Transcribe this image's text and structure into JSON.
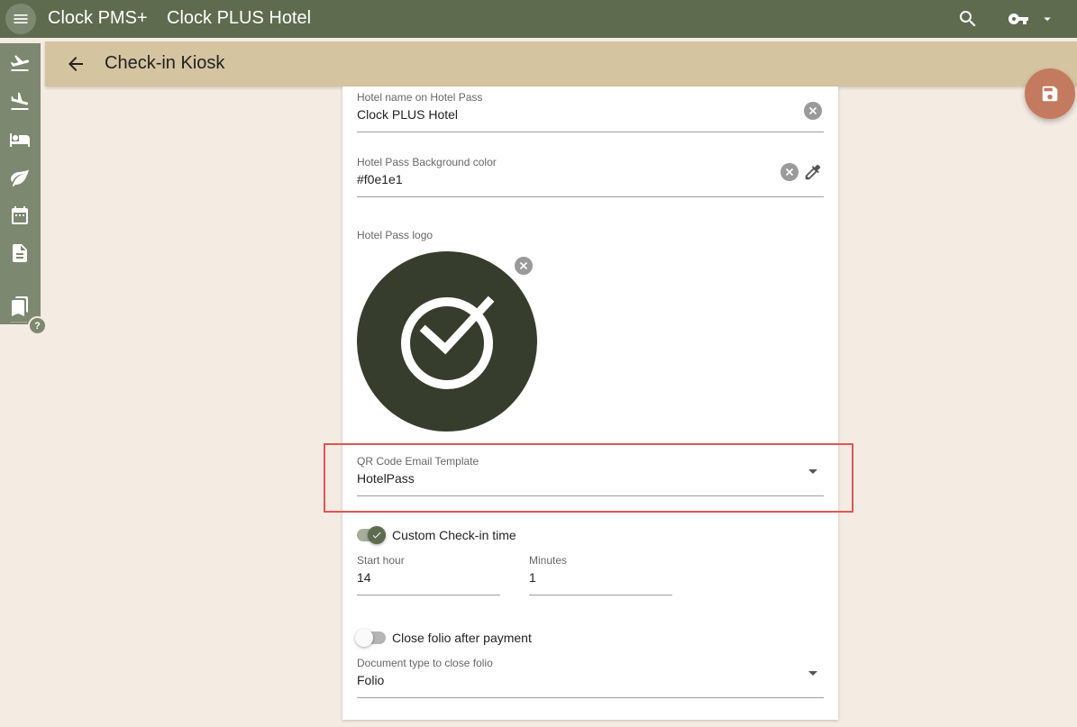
{
  "header": {
    "app_name": "Clock PMS+",
    "hotel_name": "Clock PLUS Hotel",
    "icons": [
      "menu-icon",
      "search-icon",
      "key-icon",
      "caret-down-icon"
    ]
  },
  "sidenav": {
    "icons": [
      "departures-icon",
      "arrivals-icon",
      "bed-icon",
      "leaf-icon",
      "calendar-icon",
      "document-icon",
      "bookmarks-icon"
    ],
    "help_label": "?"
  },
  "subheader": {
    "title": "Check-in Kiosk"
  },
  "form": {
    "hotel_name_field": {
      "label": "Hotel name on Hotel Pass",
      "value": "Clock PLUS Hotel"
    },
    "bg_color_field": {
      "label": "Hotel Pass Background color",
      "value": "#f0e1e1"
    },
    "logo": {
      "label": "Hotel Pass logo"
    },
    "qr_template": {
      "label": "QR Code Email Template",
      "value": "HotelPass"
    },
    "custom_checkin": {
      "label": "Custom Check-in time",
      "checked": true
    },
    "start_hour": {
      "label": "Start hour",
      "value": "14"
    },
    "minutes": {
      "label": "Minutes",
      "value": "1"
    },
    "close_folio": {
      "label": "Close folio after payment",
      "checked": false
    },
    "doc_type": {
      "label": "Document type to close folio",
      "value": "Folio"
    }
  },
  "colors": {
    "topbar": "#5f6b4e",
    "sidenav": "#7d8870",
    "subbar": "#d4c4a0",
    "page_bg": "#f4ebe3",
    "fab": "#c47a5e",
    "logo_bg": "#363d2c",
    "highlight": "#e05555"
  }
}
